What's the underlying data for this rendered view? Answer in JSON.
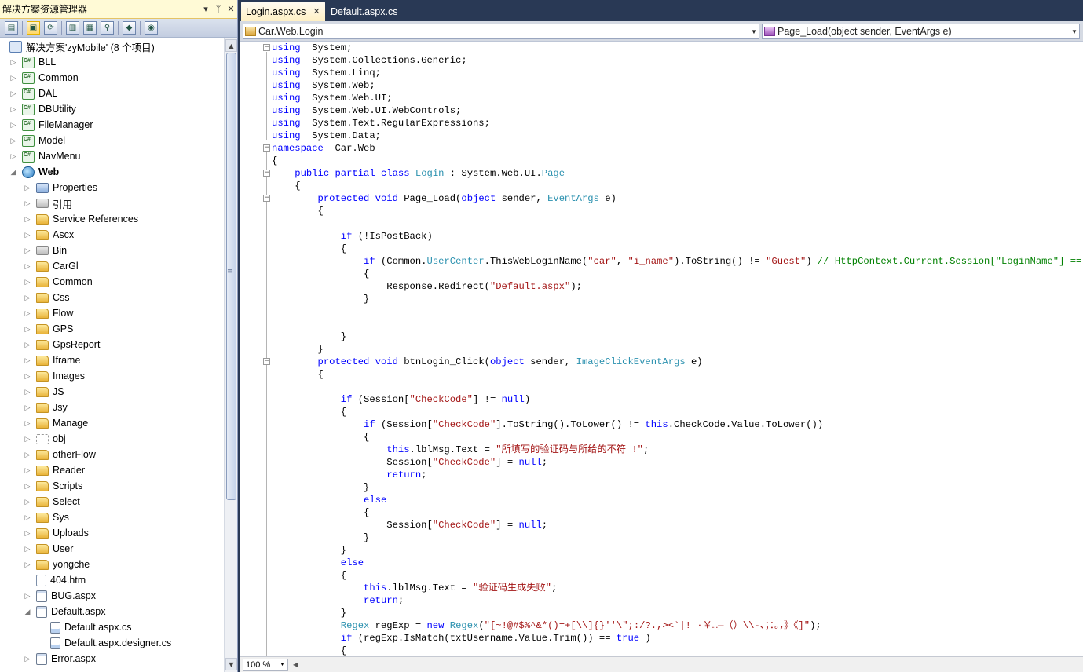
{
  "solution_explorer": {
    "title": "解决方案资源管理器",
    "controls": [
      "▾",
      "ᛘ",
      "✕"
    ],
    "toolbar_icons": [
      "properties-icon",
      "show-all-files-icon",
      "refresh-icon",
      "view-code-icon",
      "view-designer-icon",
      "view-class-diagram-icon",
      "copy-website-icon",
      "asp-config-icon"
    ],
    "tree": [
      {
        "label": "解决方案'zyMobile' (8 个项目)",
        "icon": "sol",
        "indent": 0,
        "arrow": ""
      },
      {
        "label": "BLL",
        "icon": "proj",
        "indent": 1,
        "arrow": "▷"
      },
      {
        "label": "Common",
        "icon": "proj",
        "indent": 1,
        "arrow": "▷"
      },
      {
        "label": "DAL",
        "icon": "proj",
        "indent": 1,
        "arrow": "▷"
      },
      {
        "label": "DBUtility",
        "icon": "proj",
        "indent": 1,
        "arrow": "▷"
      },
      {
        "label": "FileManager",
        "icon": "proj",
        "indent": 1,
        "arrow": "▷"
      },
      {
        "label": "Model",
        "icon": "proj",
        "indent": 1,
        "arrow": "▷"
      },
      {
        "label": "NavMenu",
        "icon": "proj",
        "indent": 1,
        "arrow": "▷"
      },
      {
        "label": "Web",
        "icon": "web",
        "indent": 1,
        "arrow": "◢",
        "bold": true
      },
      {
        "label": "Properties",
        "icon": "props",
        "indent": 2,
        "arrow": "▷"
      },
      {
        "label": "引用",
        "icon": "ref",
        "indent": 2,
        "arrow": "▷"
      },
      {
        "label": "Service References",
        "icon": "folder",
        "indent": 2,
        "arrow": "▷"
      },
      {
        "label": "Ascx",
        "icon": "folder",
        "indent": 2,
        "arrow": "▷"
      },
      {
        "label": "Bin",
        "icon": "ref",
        "indent": 2,
        "arrow": "▷"
      },
      {
        "label": "CarGl",
        "icon": "folder",
        "indent": 2,
        "arrow": "▷"
      },
      {
        "label": "Common",
        "icon": "folder",
        "indent": 2,
        "arrow": "▷"
      },
      {
        "label": "Css",
        "icon": "folder",
        "indent": 2,
        "arrow": "▷"
      },
      {
        "label": "Flow",
        "icon": "folder",
        "indent": 2,
        "arrow": "▷"
      },
      {
        "label": "GPS",
        "icon": "folder",
        "indent": 2,
        "arrow": "▷"
      },
      {
        "label": "GpsReport",
        "icon": "folder",
        "indent": 2,
        "arrow": "▷"
      },
      {
        "label": "Iframe",
        "icon": "folder",
        "indent": 2,
        "arrow": "▷"
      },
      {
        "label": "Images",
        "icon": "folder",
        "indent": 2,
        "arrow": "▷"
      },
      {
        "label": "JS",
        "icon": "folder",
        "indent": 2,
        "arrow": "▷"
      },
      {
        "label": "Jsy",
        "icon": "folder",
        "indent": 2,
        "arrow": "▷"
      },
      {
        "label": "Manage",
        "icon": "folder",
        "indent": 2,
        "arrow": "▷"
      },
      {
        "label": "obj",
        "icon": "dashfolder",
        "indent": 2,
        "arrow": "▷"
      },
      {
        "label": "otherFlow",
        "icon": "folder",
        "indent": 2,
        "arrow": "▷"
      },
      {
        "label": "Reader",
        "icon": "folder",
        "indent": 2,
        "arrow": "▷"
      },
      {
        "label": "Scripts",
        "icon": "folder",
        "indent": 2,
        "arrow": "▷"
      },
      {
        "label": "Select",
        "icon": "folder",
        "indent": 2,
        "arrow": "▷"
      },
      {
        "label": "Sys",
        "icon": "folder",
        "indent": 2,
        "arrow": "▷"
      },
      {
        "label": "Uploads",
        "icon": "folder",
        "indent": 2,
        "arrow": "▷"
      },
      {
        "label": "User",
        "icon": "folder",
        "indent": 2,
        "arrow": "▷"
      },
      {
        "label": "yongche",
        "icon": "folder",
        "indent": 2,
        "arrow": "▷"
      },
      {
        "label": "404.htm",
        "icon": "file",
        "indent": 2,
        "arrow": ""
      },
      {
        "label": "BUG.aspx",
        "icon": "aspx",
        "indent": 2,
        "arrow": "▷"
      },
      {
        "label": "Default.aspx",
        "icon": "aspx",
        "indent": 2,
        "arrow": "◢"
      },
      {
        "label": "Default.aspx.cs",
        "icon": "cs",
        "indent": 3,
        "arrow": ""
      },
      {
        "label": "Default.aspx.designer.cs",
        "icon": "cs",
        "indent": 3,
        "arrow": ""
      },
      {
        "label": "Error.aspx",
        "icon": "aspx",
        "indent": 2,
        "arrow": "▷"
      }
    ]
  },
  "editor": {
    "tabs": [
      {
        "label": "Login.aspx.cs",
        "active": true,
        "close": "✕"
      },
      {
        "label": "Default.aspx.cs",
        "active": false
      }
    ],
    "type_combo": "Car.Web.Login",
    "member_combo": "Page_Load(object sender, EventArgs e)",
    "zoom": "100 %",
    "code_lines": [
      [
        [
          "kw",
          "using"
        ],
        [
          "",
          "  System;"
        ]
      ],
      [
        [
          "kw",
          "using"
        ],
        [
          "",
          "  System.Collections.Generic;"
        ]
      ],
      [
        [
          "kw",
          "using"
        ],
        [
          "",
          "  System.Linq;"
        ]
      ],
      [
        [
          "kw",
          "using"
        ],
        [
          "",
          "  System.Web;"
        ]
      ],
      [
        [
          "kw",
          "using"
        ],
        [
          "",
          "  System.Web.UI;"
        ]
      ],
      [
        [
          "kw",
          "using"
        ],
        [
          "",
          "  System.Web.UI.WebControls;"
        ]
      ],
      [
        [
          "kw",
          "using"
        ],
        [
          "",
          "  System.Text.RegularExpressions;"
        ]
      ],
      [
        [
          "kw",
          "using"
        ],
        [
          "",
          "  System.Data;"
        ]
      ],
      [
        [
          "kw",
          "namespace"
        ],
        [
          "",
          "  Car.Web"
        ]
      ],
      [
        [
          "",
          "{"
        ]
      ],
      [
        [
          "",
          "    "
        ],
        [
          "kw",
          "public partial class"
        ],
        [
          "",
          " "
        ],
        [
          "ty",
          "Login"
        ],
        [
          "",
          " : System.Web.UI."
        ],
        [
          "ty",
          "Page"
        ]
      ],
      [
        [
          "",
          "    {"
        ]
      ],
      [
        [
          "",
          "        "
        ],
        [
          "kw",
          "protected void"
        ],
        [
          "",
          " Page_Load("
        ],
        [
          "kw",
          "object"
        ],
        [
          "",
          " sender, "
        ],
        [
          "ty",
          "EventArgs"
        ],
        [
          "",
          " e)"
        ]
      ],
      [
        [
          "",
          "        {"
        ]
      ],
      [
        [
          "",
          ""
        ]
      ],
      [
        [
          "",
          "            "
        ],
        [
          "kw",
          "if"
        ],
        [
          "",
          " (!IsPostBack)"
        ]
      ],
      [
        [
          "",
          "            {"
        ]
      ],
      [
        [
          "",
          "                "
        ],
        [
          "kw",
          "if"
        ],
        [
          "",
          " (Common."
        ],
        [
          "ty",
          "UserCenter"
        ],
        [
          "",
          ".ThisWebLoginName("
        ],
        [
          "st",
          "\"car\""
        ],
        [
          "",
          ", "
        ],
        [
          "st",
          "\"i_name\""
        ],
        [
          "",
          ").ToString() != "
        ],
        [
          "st",
          "\"Guest\""
        ],
        [
          "",
          ") "
        ],
        [
          "cm",
          "// HttpContext.Current.Session[\"LoginName\"] == null)"
        ]
      ],
      [
        [
          "",
          "                {"
        ]
      ],
      [
        [
          "",
          "                    Response.Redirect("
        ],
        [
          "st",
          "\"Default.aspx\""
        ],
        [
          "",
          ");"
        ]
      ],
      [
        [
          "",
          "                }"
        ]
      ],
      [
        [
          "",
          ""
        ]
      ],
      [
        [
          "",
          ""
        ]
      ],
      [
        [
          "",
          "            }"
        ]
      ],
      [
        [
          "",
          "        }"
        ]
      ],
      [
        [
          "",
          "        "
        ],
        [
          "kw",
          "protected void"
        ],
        [
          "",
          " btnLogin_Click("
        ],
        [
          "kw",
          "object"
        ],
        [
          "",
          " sender, "
        ],
        [
          "ty",
          "ImageClickEventArgs"
        ],
        [
          "",
          " e)"
        ]
      ],
      [
        [
          "",
          "        {"
        ]
      ],
      [
        [
          "",
          ""
        ]
      ],
      [
        [
          "",
          "            "
        ],
        [
          "kw",
          "if"
        ],
        [
          "",
          " (Session["
        ],
        [
          "st",
          "\"CheckCode\""
        ],
        [
          "",
          "] != "
        ],
        [
          "kw",
          "null"
        ],
        [
          "",
          ")"
        ]
      ],
      [
        [
          "",
          "            {"
        ]
      ],
      [
        [
          "",
          "                "
        ],
        [
          "kw",
          "if"
        ],
        [
          "",
          " (Session["
        ],
        [
          "st",
          "\"CheckCode\""
        ],
        [
          "",
          "].ToString().ToLower() != "
        ],
        [
          "kw",
          "this"
        ],
        [
          "",
          ".CheckCode.Value.ToLower())"
        ]
      ],
      [
        [
          "",
          "                {"
        ]
      ],
      [
        [
          "",
          "                    "
        ],
        [
          "kw",
          "this"
        ],
        [
          "",
          ".lblMsg.Text = "
        ],
        [
          "st",
          "\"所填写的验证码与所给的不符 !\""
        ],
        [
          "",
          ";"
        ]
      ],
      [
        [
          "",
          "                    Session["
        ],
        [
          "st",
          "\"CheckCode\""
        ],
        [
          "",
          "] = "
        ],
        [
          "kw",
          "null"
        ],
        [
          "",
          ";"
        ]
      ],
      [
        [
          "",
          "                    "
        ],
        [
          "kw",
          "return"
        ],
        [
          "",
          ";"
        ]
      ],
      [
        [
          "",
          "                }"
        ]
      ],
      [
        [
          "",
          "                "
        ],
        [
          "kw",
          "else"
        ]
      ],
      [
        [
          "",
          "                {"
        ]
      ],
      [
        [
          "",
          "                    Session["
        ],
        [
          "st",
          "\"CheckCode\""
        ],
        [
          "",
          "] = "
        ],
        [
          "kw",
          "null"
        ],
        [
          "",
          ";"
        ]
      ],
      [
        [
          "",
          "                }"
        ]
      ],
      [
        [
          "",
          "            }"
        ]
      ],
      [
        [
          "",
          "            "
        ],
        [
          "kw",
          "else"
        ]
      ],
      [
        [
          "",
          "            {"
        ]
      ],
      [
        [
          "",
          "                "
        ],
        [
          "kw",
          "this"
        ],
        [
          "",
          ".lblMsg.Text = "
        ],
        [
          "st",
          "\"验证码生成失败\""
        ],
        [
          "",
          ";"
        ]
      ],
      [
        [
          "",
          "                "
        ],
        [
          "kw",
          "return"
        ],
        [
          "",
          ";"
        ]
      ],
      [
        [
          "",
          "            }"
        ]
      ],
      [
        [
          "",
          "            "
        ],
        [
          "ty",
          "Regex"
        ],
        [
          "",
          " regExp = "
        ],
        [
          "kw",
          "new"
        ],
        [
          "",
          " "
        ],
        [
          "ty",
          "Regex"
        ],
        [
          "",
          "("
        ],
        [
          "st",
          "\"[~!@#$%^&*()=+[\\\\]{}''\\\";:/?.,><`|! ·￥…—（）\\\\-、；：。，》《]\""
        ],
        [
          "",
          ");"
        ]
      ],
      [
        [
          "",
          "            "
        ],
        [
          "kw",
          "if"
        ],
        [
          "",
          " (regExp.IsMatch(txtUsername.Value.Trim()) == "
        ],
        [
          "kw",
          "true"
        ],
        [
          "",
          " )"
        ]
      ],
      [
        [
          "",
          "            {"
        ]
      ]
    ]
  }
}
